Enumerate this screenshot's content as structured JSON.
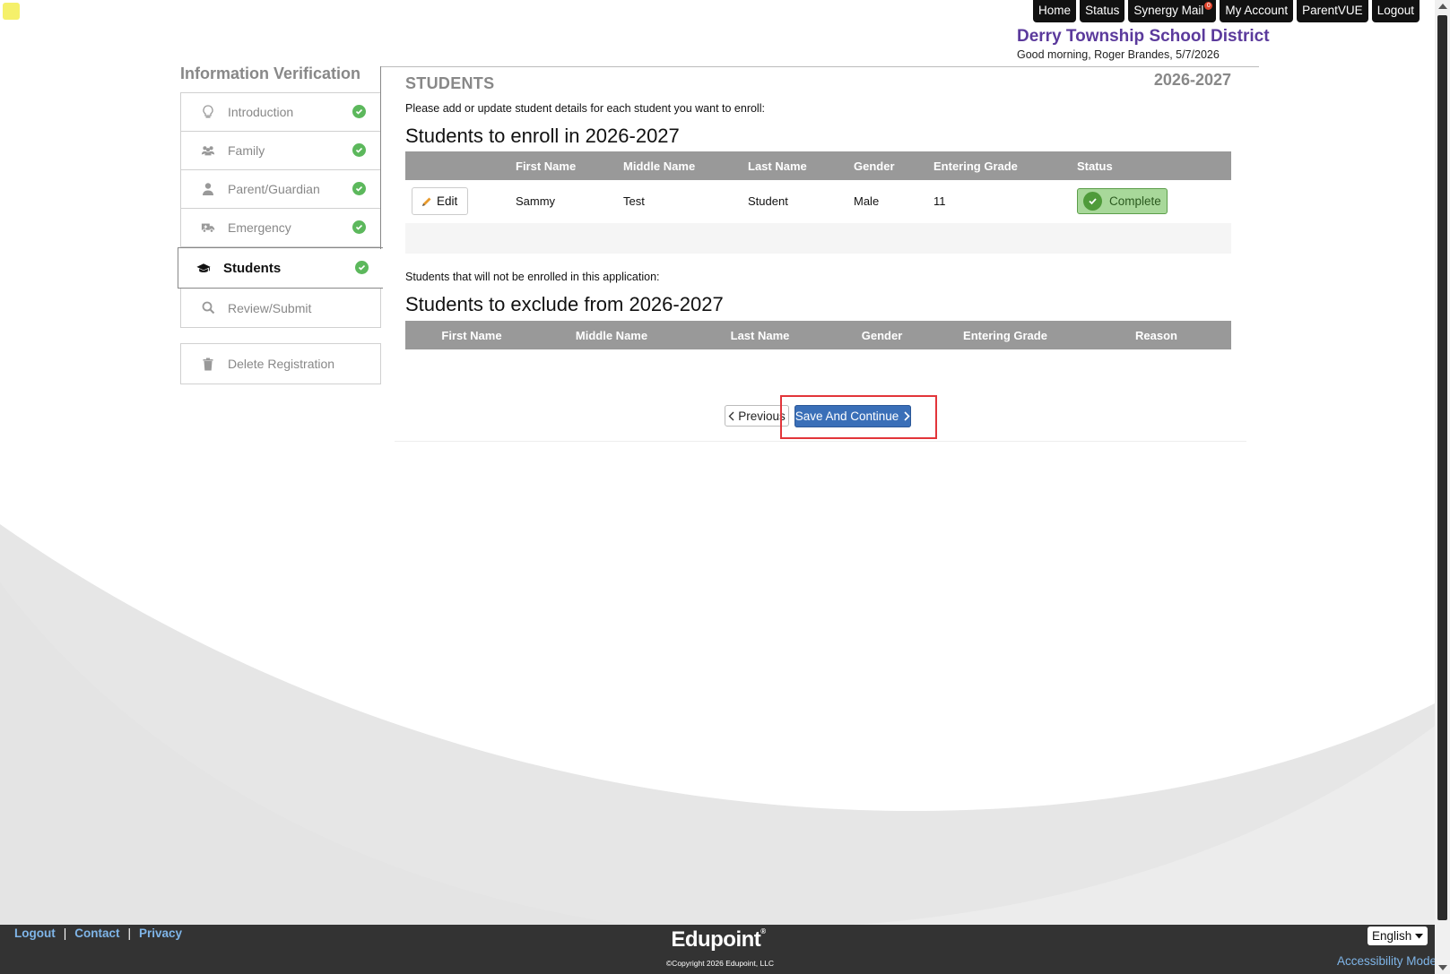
{
  "colors": {
    "district_name": "#5b3a9c",
    "primary_button": "#3a6fb8",
    "complete_green": "#a8d89a",
    "check_green": "#5cb85c",
    "table_header": "#999999",
    "footer_bg": "#333333",
    "link": "#7fb5e8",
    "highlight": "#e2353a"
  },
  "topnav": {
    "home": "Home",
    "status": "Status",
    "synergy_mail": "Synergy Mail",
    "mail_badge": "0",
    "my_account": "My Account",
    "parentvue": "ParentVUE",
    "logout": "Logout"
  },
  "district": {
    "name": "Derry Township School District",
    "greeting": "Good morning, Roger Brandes, 5/7/2026"
  },
  "sidebar": {
    "heading": "Information Verification",
    "items": [
      {
        "label": "Introduction",
        "icon": "lightbulb-icon",
        "complete": true
      },
      {
        "label": "Family",
        "icon": "users-icon",
        "complete": true
      },
      {
        "label": "Parent/Guardian",
        "icon": "user-icon",
        "complete": true
      },
      {
        "label": "Emergency",
        "icon": "ambulance-icon",
        "complete": true
      },
      {
        "label": "Students",
        "icon": "graduation-cap-icon",
        "complete": true,
        "active": true
      },
      {
        "label": "Review/Submit",
        "icon": "search-icon",
        "complete": false
      }
    ],
    "delete_label": "Delete Registration"
  },
  "main": {
    "section_title": "STUDENTS",
    "year": "2026-2027",
    "instructions": "Please add or update student details for each student you want to enroll:",
    "enroll_heading": "Students to enroll in 2026-2027",
    "enroll_columns": [
      "",
      "First Name",
      "Middle Name",
      "Last Name",
      "Gender",
      "Entering Grade",
      "Status"
    ],
    "enroll_rows": [
      {
        "edit_label": "Edit",
        "first_name": "Sammy",
        "middle_name": "Test",
        "last_name": "Student",
        "gender": "Male",
        "entering_grade": "11",
        "status": "Complete"
      }
    ],
    "not_enrolled_text": "Students that will not be enrolled in this application:",
    "exclude_heading": "Students to exclude from 2026-2027",
    "exclude_columns": [
      "First Name",
      "Middle Name",
      "Last Name",
      "Gender",
      "Entering Grade",
      "Reason"
    ],
    "previous_label": "Previous",
    "save_label": "Save And Continue"
  },
  "footer": {
    "logout": "Logout",
    "contact": "Contact",
    "privacy": "Privacy",
    "logo": "Edupoint",
    "copyright": "©Copyright 2026 Edupoint, LLC",
    "language": "English",
    "accessibility": "Accessibility Mode"
  }
}
